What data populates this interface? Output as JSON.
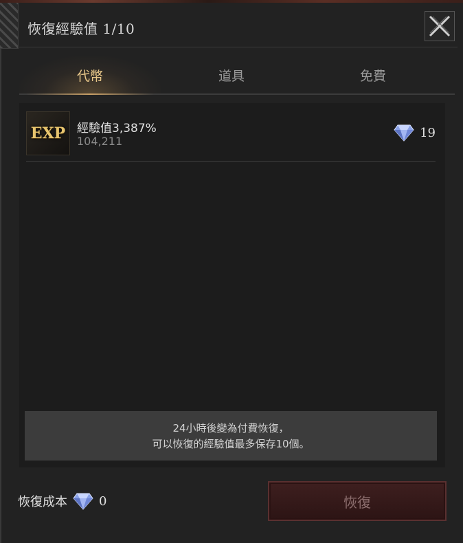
{
  "window": {
    "title": "恢復經驗值 1/10"
  },
  "tabs": [
    {
      "label": "代幣",
      "active": true
    },
    {
      "label": "道具",
      "active": false
    },
    {
      "label": "免費",
      "active": false
    }
  ],
  "item": {
    "icon_label": "EXP",
    "name": "經驗值3,387%",
    "amount": "104,211",
    "price": "19",
    "price_icon": "diamond-icon"
  },
  "notice": {
    "line1": "24小時後變為付費恢復，",
    "line2": "可以恢復的經驗值最多保存10個。"
  },
  "footer": {
    "cost_label": "恢復成本",
    "cost_value": "0",
    "restore_label": "恢復"
  },
  "colors": {
    "active_tab": "#e9c88a",
    "button_bg": "#3e1f1f"
  }
}
